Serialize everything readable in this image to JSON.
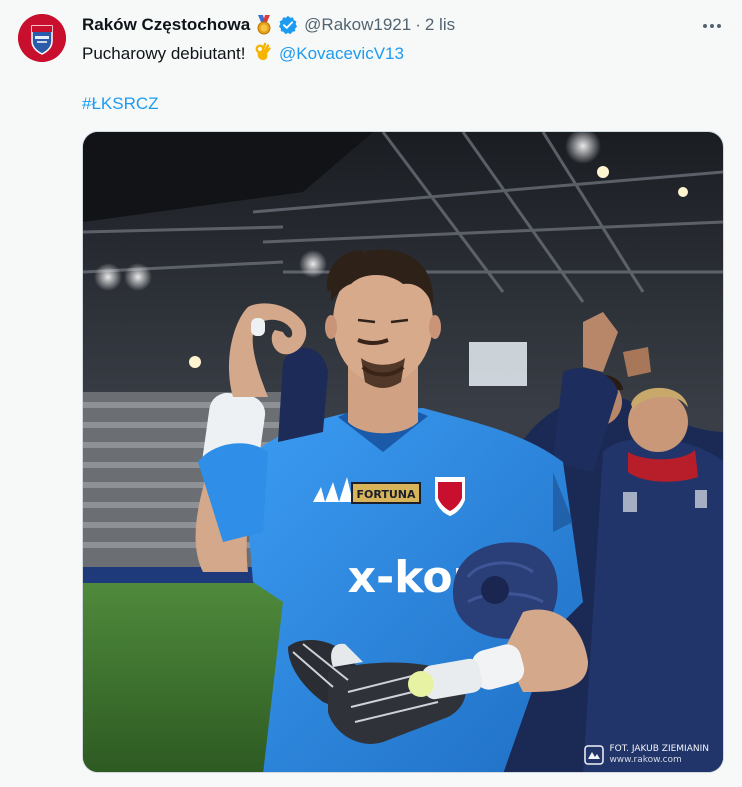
{
  "tweet": {
    "author": {
      "display_name": "Raków Częstochowa",
      "handle": "@Rakow1921",
      "separator": "·",
      "date": "2 lis",
      "badge_icons": [
        "gold-medal-icon",
        "verified-badge-icon"
      ]
    },
    "text": {
      "line1_prefix": "Pucharowy debiutant!",
      "emoji": "ok-hand-emoji",
      "mention": "@KovacevicV13",
      "hashtag": "#ŁKSRCZ"
    },
    "media": {
      "photo_credit_line1": "FOT. JAKUB ZIEMIANIN",
      "photo_credit_line2": "www.rakow.com",
      "jersey_sponsor": "FORTUNA",
      "jersey_main": "x-kom"
    },
    "colors": {
      "link": "#1d9bf0",
      "muted": "#536471",
      "background": "#f7f9f9",
      "club_red": "#c8102e",
      "jersey_blue": "#2f8fe8"
    }
  }
}
